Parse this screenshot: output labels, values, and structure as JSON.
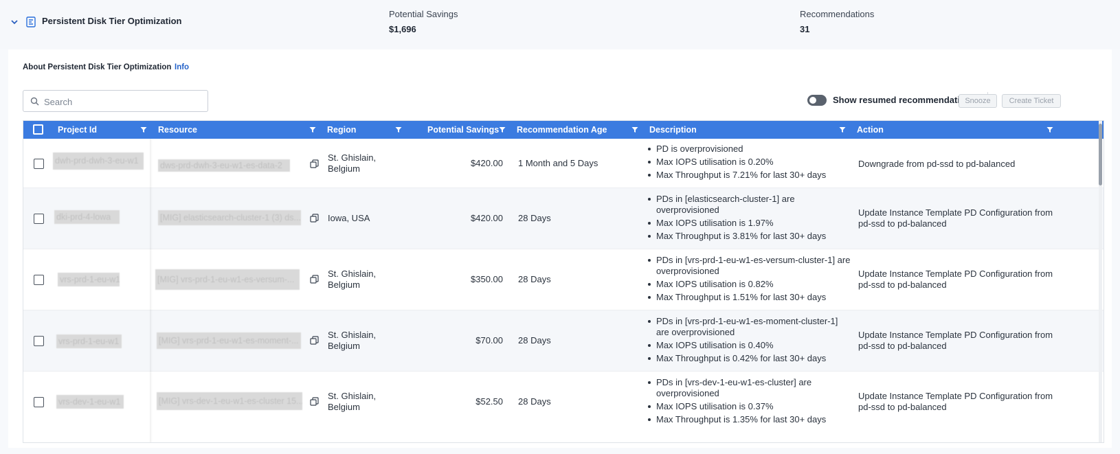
{
  "header": {
    "title": "Persistent Disk Tier Optimization",
    "potential_savings_label": "Potential Savings",
    "potential_savings_value": "$1,696",
    "recommendations_label": "Recommendations",
    "recommendations_value": "31"
  },
  "about": {
    "text": "About Persistent Disk Tier Optimization",
    "info_link": "Info"
  },
  "search": {
    "placeholder": "Search",
    "value": ""
  },
  "toolbar": {
    "toggle_label": "Show resumed recommendations",
    "toggle_on": false,
    "snooze_label": "Snooze",
    "create_ticket_label": "Create Ticket"
  },
  "table": {
    "columns": [
      "Project Id",
      "Resource",
      "Region",
      "Potential Savings",
      "Recommendation Age",
      "Description",
      "Action"
    ],
    "rows": [
      {
        "project_id": "dwh-prd-dwh-3-eu-w1",
        "resource": "dws-prd-dwh-3-eu-w1-es-data-2",
        "region": "St. Ghislain, Belgium",
        "savings": "$420.00",
        "age": "1 Month and 5 Days",
        "description": [
          "PD is overprovisioned",
          "Max IOPS utilisation is 0.20%",
          "Max Throughput is 7.21% for last 30+ days"
        ],
        "action": "Downgrade from pd-ssd to pd-balanced"
      },
      {
        "project_id": "dki-prd-4-lowa",
        "resource": "[MIG] elasticsearch-cluster-1 (3) ds...",
        "region": "Iowa, USA",
        "savings": "$420.00",
        "age": "28 Days",
        "description": [
          "PDs in [elasticsearch-cluster-1] are overprovisioned",
          "Max IOPS utilisation is 1.97%",
          "Max Throughput is 3.81% for last 30+ days"
        ],
        "action": "Update Instance Template PD Configuration from pd-ssd to pd-balanced"
      },
      {
        "project_id": "vrs-prd-1-eu-w1",
        "resource": "[MIG] vrs-prd-1-eu-w1-es-versum-...",
        "region": "St. Ghislain, Belgium",
        "savings": "$350.00",
        "age": "28 Days",
        "description": [
          "PDs in [vrs-prd-1-eu-w1-es-versum-cluster-1] are overprovisioned",
          "Max IOPS utilisation is 0.82%",
          "Max Throughput is 1.51% for last 30+ days"
        ],
        "action": "Update Instance Template PD Configuration from pd-ssd to pd-balanced"
      },
      {
        "project_id": "vrs-prd-1-eu-w1",
        "resource": "[MIG] vrs-prd-1-eu-w1-es-moment-...",
        "region": "St. Ghislain, Belgium",
        "savings": "$70.00",
        "age": "28 Days",
        "description": [
          "PDs in [vrs-prd-1-eu-w1-es-moment-cluster-1] are overprovisioned",
          "Max IOPS utilisation is 0.40%",
          "Max Throughput is 0.42% for last 30+ days"
        ],
        "action": "Update Instance Template PD Configuration from pd-ssd to pd-balanced"
      },
      {
        "project_id": "vrs-dev-1-eu-w1",
        "resource": "[MIG] vrs-dev-1-eu-w1-es-cluster 15...",
        "region": "St. Ghislain, Belgium",
        "savings": "$52.50",
        "age": "28 Days",
        "description": [
          "PDs in [vrs-dev-1-eu-w1-es-cluster] are overprovisioned",
          "Max IOPS utilisation is 0.37%",
          "Max Throughput is 1.35% for last 30+ days"
        ],
        "action": "Update Instance Template PD Configuration from pd-ssd to pd-balanced"
      }
    ]
  },
  "colors": {
    "accent": "#3b7be0",
    "link": "#2563c9",
    "header_bg": "#f6f8fb"
  }
}
